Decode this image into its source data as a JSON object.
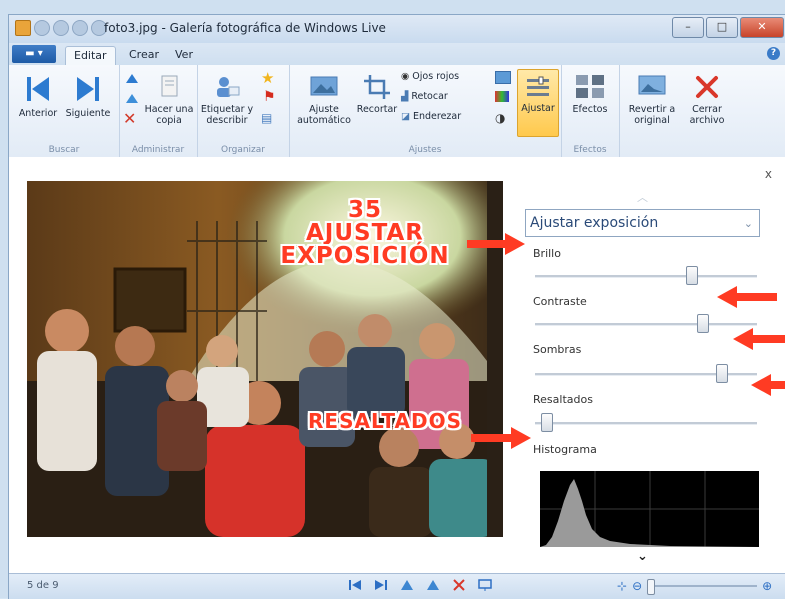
{
  "window": {
    "title": "foto3.jpg - Galería fotográfica de Windows Live"
  },
  "ribbon_tabs": {
    "file_tab": "",
    "tabs": [
      "Editar",
      "Crear",
      "Ver"
    ]
  },
  "ribbon": {
    "groups": {
      "browse": {
        "name": "Buscar",
        "prev": "Anterior",
        "next": "Siguiente"
      },
      "manage": {
        "name": "Administrar",
        "copy": "Hacer una copia"
      },
      "organize": {
        "name": "Organizar",
        "tag": "Etiquetar y describir"
      },
      "adjust": {
        "name": "Ajustes",
        "auto": "Ajuste automático",
        "crop": "Recortar",
        "redeye": "Ojos rojos",
        "retouch": "Retocar",
        "straighten": "Enderezar",
        "adjust": "Ajustar"
      },
      "effects": {
        "name": "Efectos",
        "effects": "Efectos"
      },
      "revert": {
        "label": "Revertir a original"
      },
      "close": {
        "label": "Cerrar archivo"
      }
    }
  },
  "annotations": {
    "step": "35",
    "line1": "AJUSTAR",
    "line2": "EXPOSICIÓN",
    "highlights": "RESALTADOS"
  },
  "panel": {
    "dropdown": "Ajustar exposición",
    "close": "x",
    "sliders": [
      {
        "label": "Brillo",
        "value": 0.72
      },
      {
        "label": "Contraste",
        "value": 0.77
      },
      {
        "label": "Sombras",
        "value": 0.86
      },
      {
        "label": "Resaltados",
        "value": 0.03
      }
    ],
    "histogram_label": "Histograma"
  },
  "status": {
    "counter": "5 de 9",
    "zoom_value": 0.0
  },
  "colors": {
    "accent_red": "#ff3b23",
    "ribbon_active": "#ffd87a"
  }
}
